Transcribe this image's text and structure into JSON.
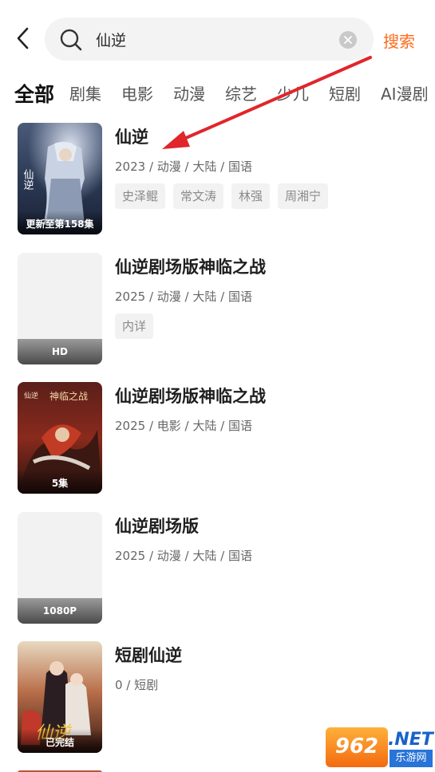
{
  "header": {
    "search_value": "仙逆",
    "search_button": "搜索"
  },
  "tabs": [
    "全部",
    "剧集",
    "电影",
    "动漫",
    "综艺",
    "少儿",
    "短剧",
    "AI漫剧"
  ],
  "results": [
    {
      "title": "仙逆",
      "meta": "2023 / 动漫 / 大陆 / 国语",
      "badge": "更新至第158集",
      "tags": [
        "史泽鲲",
        "常文涛",
        "林强",
        "周湘宁"
      ]
    },
    {
      "title": "仙逆剧场版神临之战",
      "meta": "2025 / 动漫 / 大陆 / 国语",
      "badge": "HD",
      "tags": [
        "内详"
      ]
    },
    {
      "title": "仙逆剧场版神临之战",
      "meta": "2025 / 电影 / 大陆 / 国语",
      "badge": "5集",
      "tags": []
    },
    {
      "title": "仙逆剧场版",
      "meta": "2025 / 动漫 / 大陆 / 国语",
      "badge": "1080P",
      "tags": []
    },
    {
      "title": "短剧仙逆",
      "meta": "0 / 短剧",
      "badge": "已完结",
      "tags": []
    }
  ],
  "poster_art_text": [
    "仙逆",
    "神临之战",
    "仙逆"
  ],
  "watermark": {
    "logo": "962",
    "net": ".NET",
    "site": "乐游网"
  },
  "colors": {
    "accent": "#ff6a1a",
    "annotation_arrow": "#e0262b"
  }
}
